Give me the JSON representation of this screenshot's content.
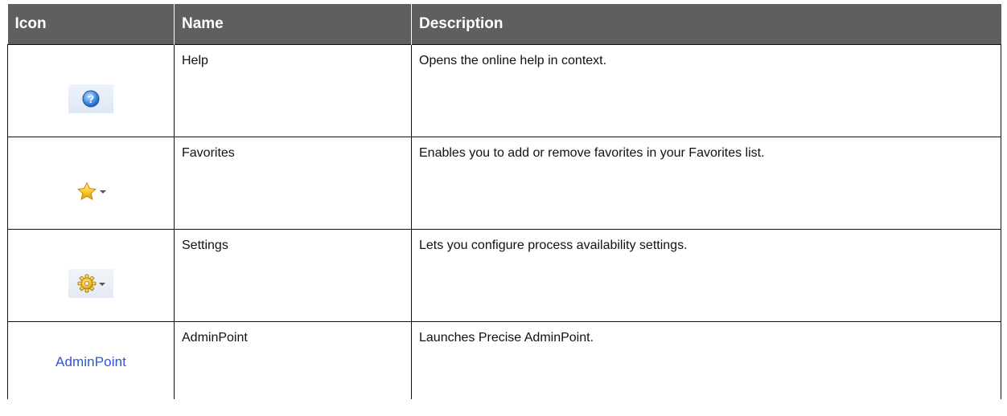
{
  "table": {
    "headers": [
      "Icon",
      "Name",
      "Description"
    ],
    "rows": [
      {
        "icon": "help-icon",
        "name": "Help",
        "description": "Opens the online help in context."
      },
      {
        "icon": "star-dropdown-icon",
        "name": "Favorites",
        "description": "Enables you to add or remove favorites in your Favorites list."
      },
      {
        "icon": "gear-dropdown-icon",
        "name": "Settings",
        "description": "Lets you configure process availability settings."
      },
      {
        "icon": "adminpoint-link",
        "icon_text": "AdminPoint",
        "name": "AdminPoint",
        "description": "Launches Precise AdminPoint."
      }
    ]
  },
  "colors": {
    "header_bg": "#5f5f5f",
    "header_text": "#ffffff",
    "link": "#2e55d6",
    "border": "#111111"
  }
}
